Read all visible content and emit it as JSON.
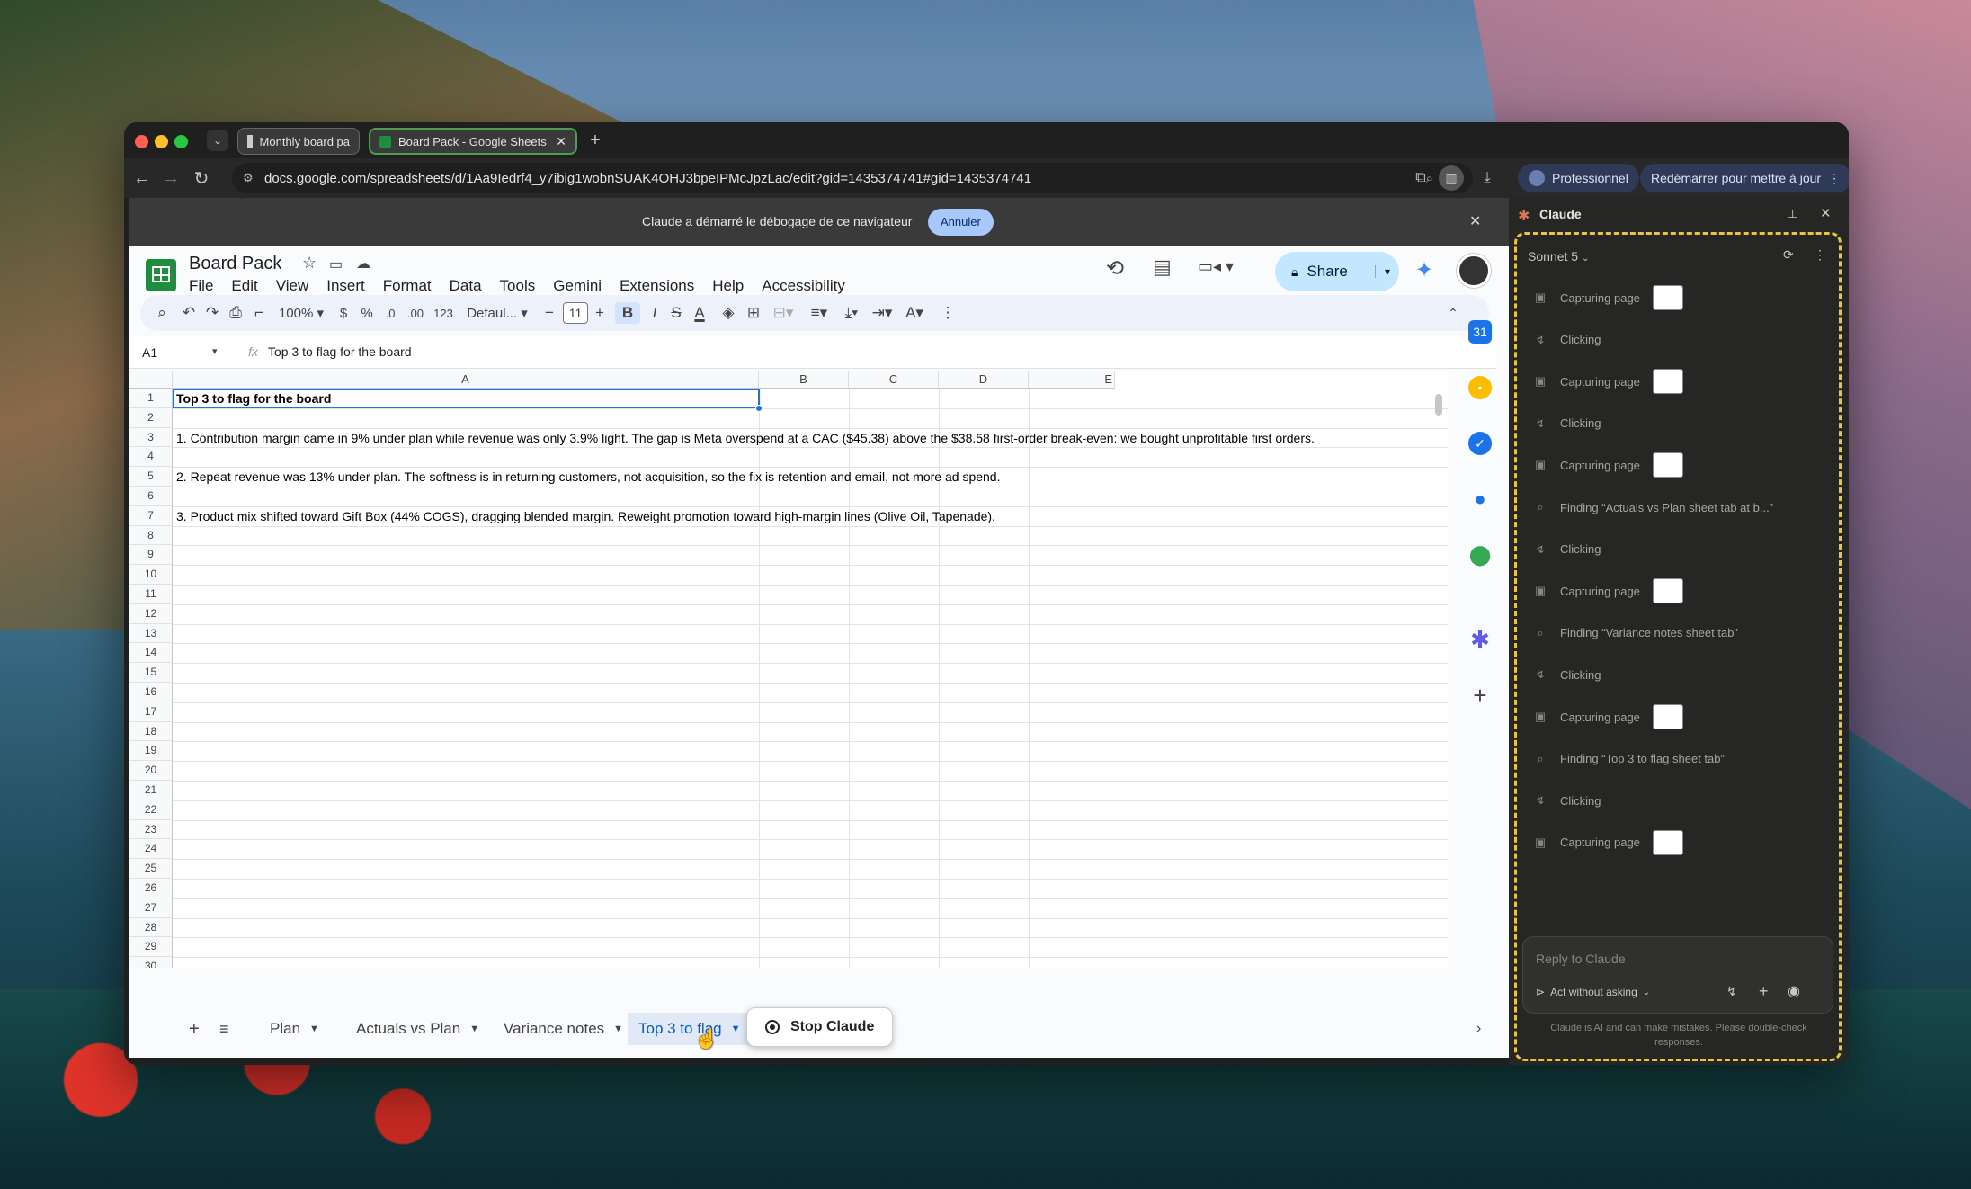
{
  "browser": {
    "tabs": [
      {
        "label": "Monthly board pa",
        "active": false
      },
      {
        "label": "Board Pack - Google Sheets",
        "active": true
      }
    ],
    "new_tab": "+",
    "url": "docs.google.com/spreadsheets/d/1Aa9Iedrf4_y7ibig1wobnSUAK4OHJ3bpeIPMcJpzLac/edit?gid=1435374741#gid=1435374741",
    "profile_label": "Professionnel",
    "update_label": "Redémarrer pour mettre à jour"
  },
  "debug_bar": {
    "message": "Claude a démarré le débogage de ce navigateur",
    "cancel_label": "Annuler"
  },
  "sheets": {
    "doc_title": "Board Pack",
    "menu": [
      "File",
      "Edit",
      "View",
      "Insert",
      "Format",
      "Data",
      "Tools",
      "Gemini",
      "Extensions",
      "Help",
      "Accessibility"
    ],
    "share_label": "Share",
    "toolbar": {
      "zoom": "100%",
      "currency": "$",
      "percent": "%",
      "dec_less": ".0",
      "dec_more": ".00",
      "number_format": "123",
      "font": "Defaul...",
      "font_size": "11"
    },
    "name_box": "A1",
    "fx": "fx",
    "formula": "Top 3 to flag for the board",
    "columns": [
      "A",
      "B",
      "C",
      "D",
      "E"
    ],
    "rows": [
      "1",
      "2",
      "3",
      "4",
      "5",
      "6",
      "7",
      "8",
      "9",
      "10",
      "11",
      "12",
      "13",
      "14",
      "15",
      "16",
      "17",
      "18",
      "19",
      "20",
      "21",
      "22",
      "23",
      "24",
      "25",
      "26",
      "27",
      "28",
      "29",
      "30"
    ],
    "cells": {
      "a1": "Top 3 to flag for the board",
      "a3": "1. Contribution margin came in 9% under plan while revenue was only 3.9% light. The gap is Meta overspend at a CAC ($45.38) above the $38.58 first-order break-even: we bought unprofitable first orders.",
      "a5": "2. Repeat revenue was 13% under plan. The softness is in returning customers, not acquisition, so the fix is retention and email, not more ad spend.",
      "a7": "3. Product mix shifted toward Gift Box (44% COGS), dragging blended margin. Reweight promotion toward high-margin lines (Olive Oil, Tapenade)."
    },
    "sheet_tabs": [
      "Plan",
      "Actuals vs Plan",
      "Variance notes",
      "Top 3 to flag"
    ],
    "active_sheet": "Top 3 to flag",
    "stop_label": "Stop Claude"
  },
  "claude": {
    "title": "Claude",
    "model": "Sonnet 5",
    "steps": [
      {
        "type": "capture",
        "label": "Capturing page"
      },
      {
        "type": "click",
        "label": "Clicking"
      },
      {
        "type": "capture",
        "label": "Capturing page"
      },
      {
        "type": "click",
        "label": "Clicking"
      },
      {
        "type": "capture",
        "label": "Capturing page"
      },
      {
        "type": "find",
        "label": "Finding “Actuals vs Plan sheet tab at b...”"
      },
      {
        "type": "click",
        "label": "Clicking"
      },
      {
        "type": "capture",
        "label": "Capturing page"
      },
      {
        "type": "find",
        "label": "Finding “Variance notes sheet tab”"
      },
      {
        "type": "click",
        "label": "Clicking"
      },
      {
        "type": "capture",
        "label": "Capturing page"
      },
      {
        "type": "find",
        "label": "Finding “Top 3 to flag sheet tab”"
      },
      {
        "type": "click",
        "label": "Clicking"
      },
      {
        "type": "capture",
        "label": "Capturing page"
      }
    ],
    "reply_placeholder": "Reply to Claude",
    "mode_label": "Act without asking",
    "disclaimer": "Claude is AI and can make mistakes. Please double-check responses."
  },
  "colors": {
    "sheets_accent": "#0b57d0",
    "share_bg": "#c2e7ff",
    "panel_border": "#e8c53a",
    "claude_orange": "#d97757"
  }
}
